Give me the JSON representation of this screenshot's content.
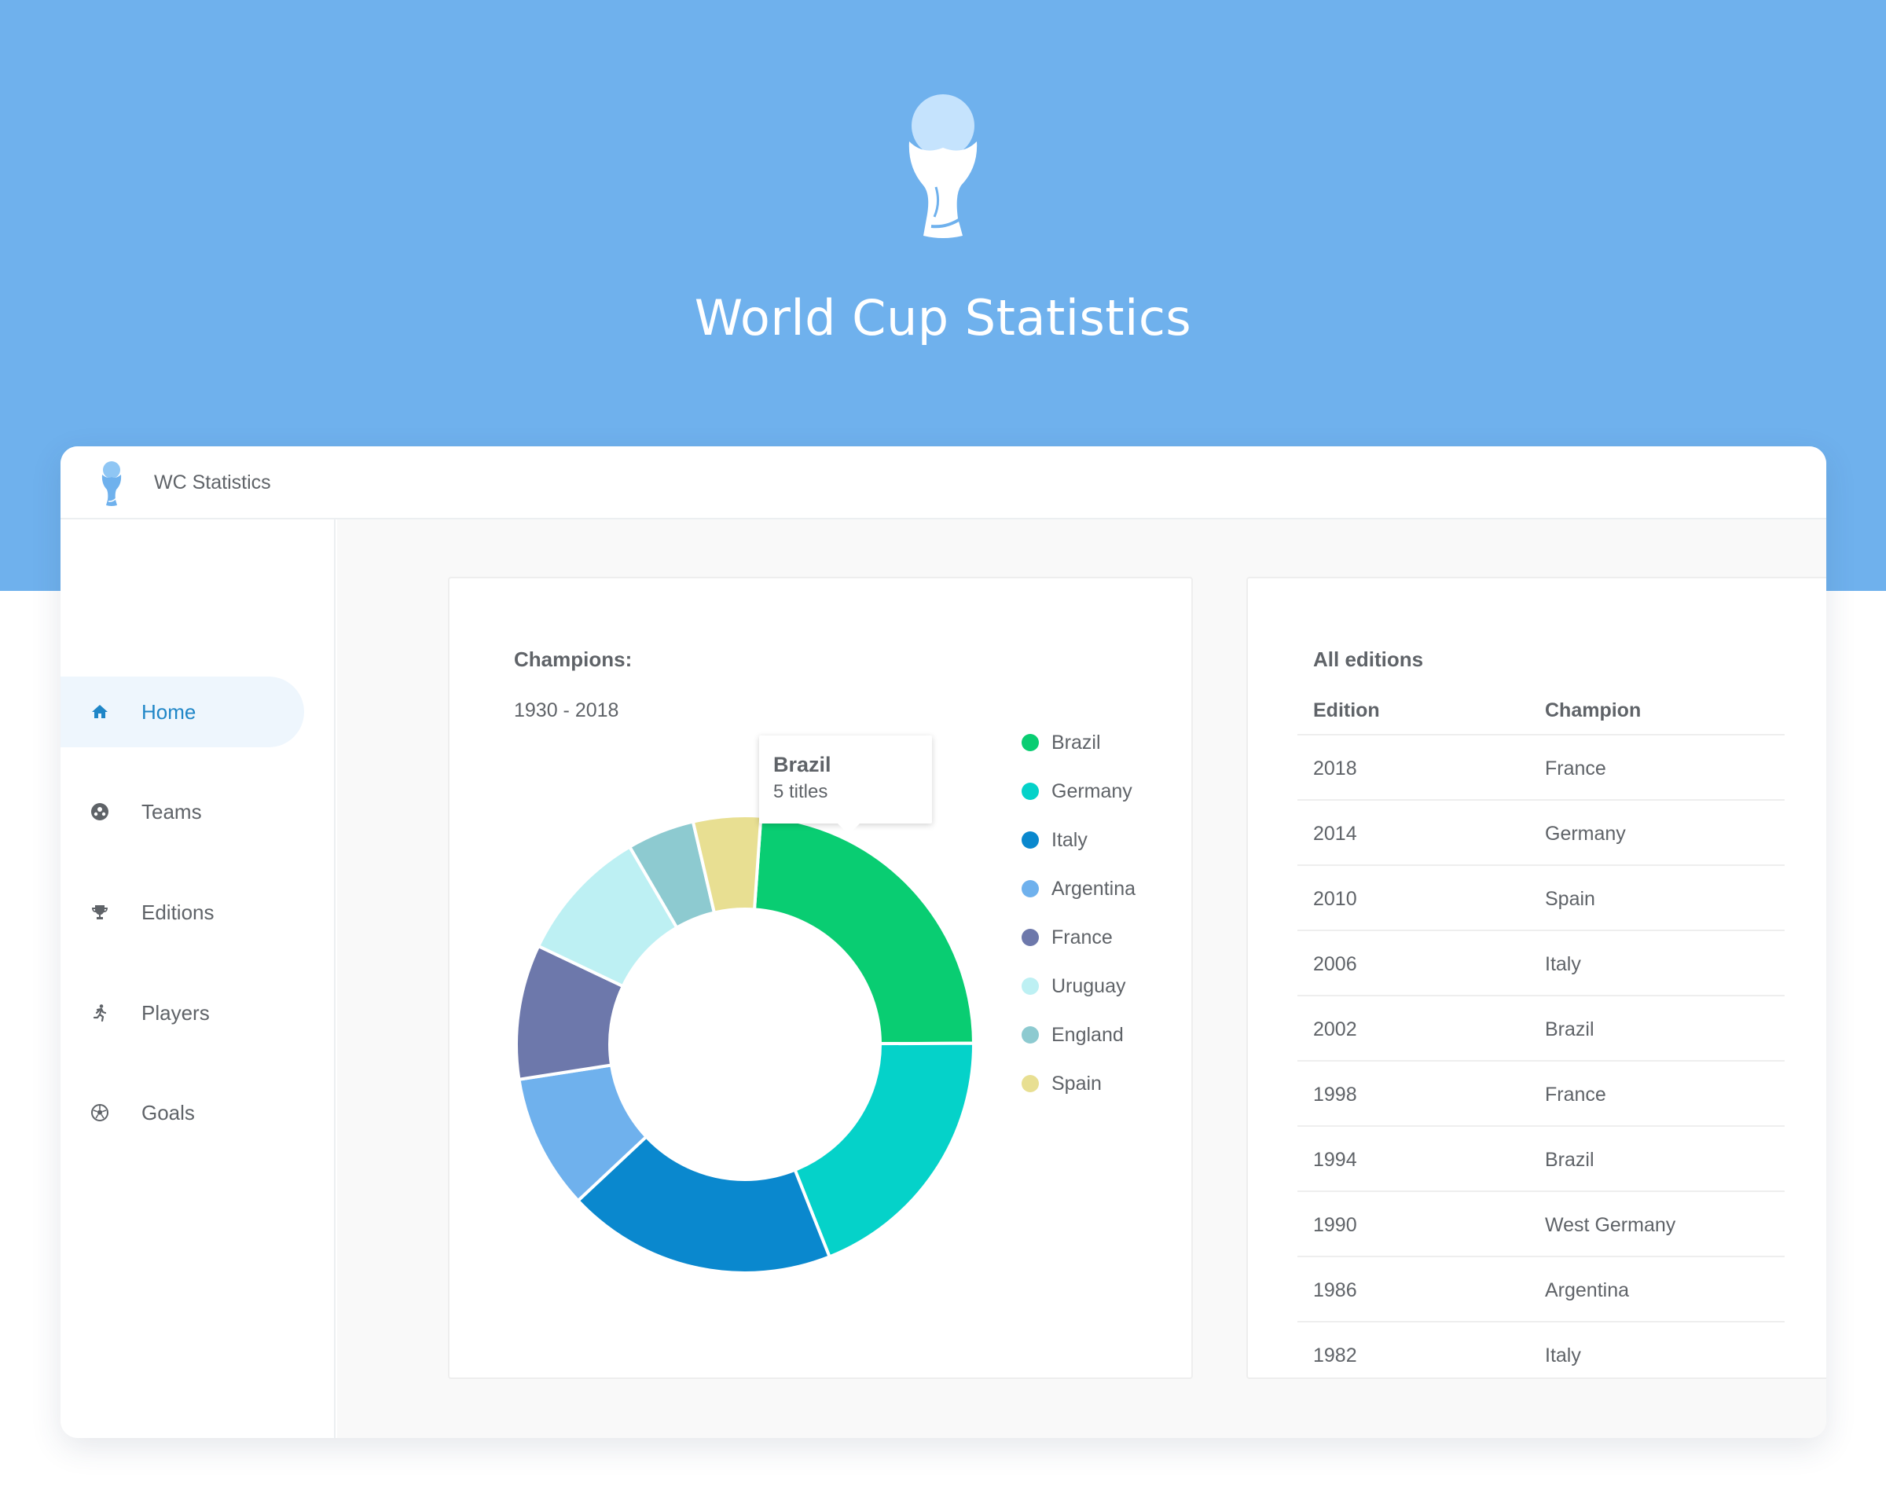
{
  "hero": {
    "title": "World Cup Statistics",
    "logo_icon": "trophy-icon"
  },
  "app": {
    "title": "WC Statistics",
    "logo_icon": "trophy-icon"
  },
  "sidebar": {
    "items": [
      {
        "label": "Home",
        "icon": "home-icon",
        "active": true
      },
      {
        "label": "Teams",
        "icon": "soccer-ball-icon",
        "active": false
      },
      {
        "label": "Editions",
        "icon": "trophy-icon",
        "active": false
      },
      {
        "label": "Players",
        "icon": "running-person-icon",
        "active": false
      },
      {
        "label": "Goals",
        "icon": "goal-ball-icon",
        "active": false
      }
    ]
  },
  "champions_card": {
    "title": "Champions:",
    "subtitle": "1930 - 2018",
    "tooltip": {
      "title": "Brazil",
      "subtitle": "5 titles"
    }
  },
  "chart_data": {
    "type": "pie",
    "variant": "donut",
    "categories": [
      "Brazil",
      "Germany",
      "Italy",
      "Argentina",
      "France",
      "Uruguay",
      "England",
      "Spain"
    ],
    "values": [
      5,
      4,
      4,
      2,
      2,
      2,
      1,
      1
    ],
    "colors": [
      "#09cd72",
      "#05d2c9",
      "#0a88ce",
      "#6fb1ed",
      "#6d78ab",
      "#bdf0f3",
      "#8dcad0",
      "#e8df92"
    ],
    "legend_position": "right"
  },
  "editions_card": {
    "title": "All editions",
    "columns": [
      "Edition",
      "Champion"
    ],
    "rows": [
      [
        "2018",
        "France"
      ],
      [
        "2014",
        "Germany"
      ],
      [
        "2010",
        "Spain"
      ],
      [
        "2006",
        "Italy"
      ],
      [
        "2002",
        "Brazil"
      ],
      [
        "1998",
        "France"
      ],
      [
        "1994",
        "Brazil"
      ],
      [
        "1990",
        "West Germany"
      ],
      [
        "1986",
        "Argentina"
      ],
      [
        "1982",
        "Italy"
      ]
    ]
  },
  "colors": {
    "hero_bg": "#6fb1ed",
    "accent": "#1f86c7",
    "active_bg": "#eef6fd"
  }
}
